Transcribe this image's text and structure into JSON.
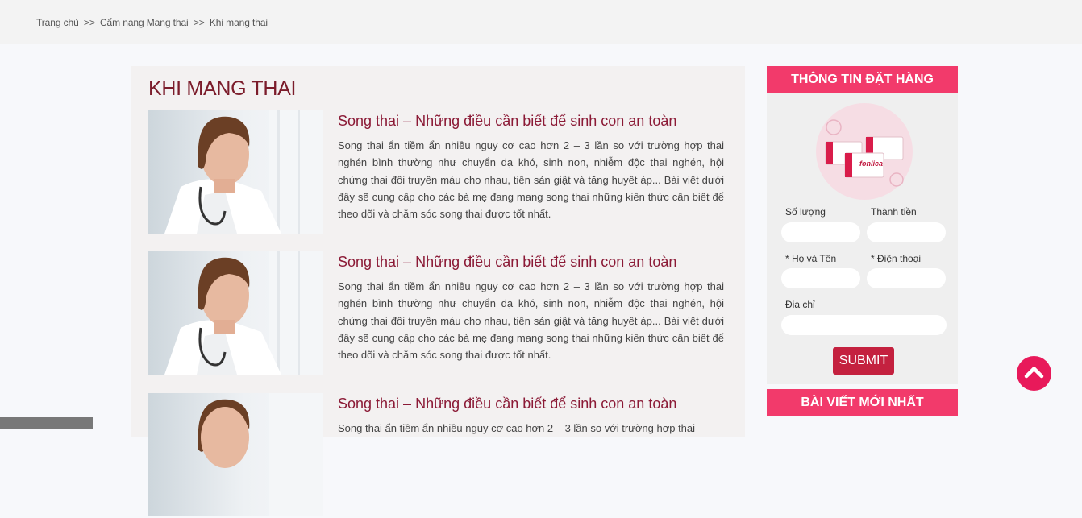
{
  "breadcrumb": {
    "home": "Trang chủ",
    "separator": ">>",
    "category": "Cẩm nang Mang thai",
    "current": "Khi mang thai"
  },
  "page_title": "KHI MANG THAI",
  "posts": [
    {
      "title": "Song thai – Những điều cần biết để sinh con an toàn",
      "excerpt": "Song thai ẩn tiềm ẩn nhiều nguy cơ cao hơn 2 – 3 lần so với trường hợp thai nghén bình thường như chuyển dạ khó, sinh non, nhiễm độc thai nghén, hội chứng thai đôi truyền máu cho nhau, tiền sản giật và tăng huyết áp... Bài viết dưới đây sẽ cung cấp cho các bà mẹ đang mang song thai những kiến thức cần biết để theo dõi và chăm sóc song thai được tốt nhất."
    },
    {
      "title": "Song thai – Những điều cần biết để sinh con an toàn",
      "excerpt": "Song thai ẩn tiềm ẩn nhiều nguy cơ cao hơn 2 – 3 lần so với trường hợp thai nghén bình thường như chuyển dạ khó, sinh non, nhiễm độc thai nghén, hội chứng thai đôi truyền máu cho nhau, tiền sản giật và tăng huyết áp... Bài viết dưới đây sẽ cung cấp cho các bà mẹ đang mang song thai những kiến thức cần biết để theo dõi và chăm sóc song thai được tốt nhất."
    },
    {
      "title": "Song thai – Những điều cần biết để sinh con an toàn",
      "excerpt": "Song thai ẩn tiềm ẩn nhiều nguy cơ cao hơn 2 – 3 lần so với trường hợp thai"
    }
  ],
  "order_form": {
    "heading": "THÔNG TIN ĐẶT HÀNG",
    "product_brand": "fonlica",
    "quantity_label": "Số lượng",
    "total_label": "Thành tiền",
    "name_label": "* Họ và Tên",
    "phone_label": "* Điện thoại",
    "address_label": "Địa chỉ",
    "submit_label": "SUBMIT"
  },
  "recent_posts": {
    "heading": "BÀI VIẾT MỚI NHẤT"
  },
  "icons": {
    "scroll_top": "chevron-up-icon"
  },
  "colors": {
    "accent_pink": "#f23a6b",
    "title_maroon": "#7b1c2b",
    "submit_red": "#c4213f",
    "scroll_top_pink": "#e8195a"
  }
}
